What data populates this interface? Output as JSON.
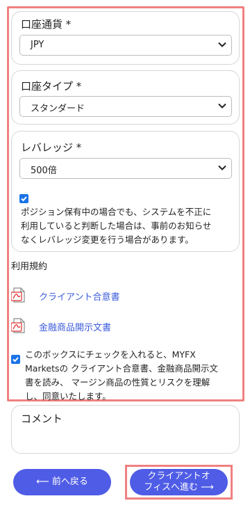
{
  "currency": {
    "label": "口座通貨 *",
    "value": "JPY"
  },
  "account_type": {
    "label": "口座タイプ *",
    "value": "スタンダード"
  },
  "leverage": {
    "label": "レバレッジ *",
    "value": "500倍",
    "notice_line1": "ポジション保有中の場合でも、システムを不正に",
    "notice_line2": "利用していると判断した場合は、事前のお知らせ",
    "notice_line3": "なくレバレッジ変更を行う場合があります。"
  },
  "terms": {
    "label": "利用規約",
    "docs": [
      {
        "label": "クライアント合意書",
        "icon": "pdf-icon"
      },
      {
        "label": "金融商品開示文書",
        "icon": "pdf-icon"
      }
    ],
    "consent_line1": "このボックスにチェックを入れると、MYFX",
    "consent_line2": "Marketsの クライアント合意書、金融商品開示文",
    "consent_line3": "書を読み、 マージン商品の性質とリスクを理解",
    "consent_line4": "し、同意いたします。"
  },
  "comment": {
    "label": "コメント"
  },
  "buttons": {
    "back": "⟵ 前へ戻る",
    "next_line1": "クライアントオ",
    "next_line2": "フィスへ進む ⟶"
  },
  "colors": {
    "accent": "#4f5ce6",
    "highlight": "#f08080",
    "link": "#3b5bdb",
    "checkbox": "#1a73e8"
  }
}
